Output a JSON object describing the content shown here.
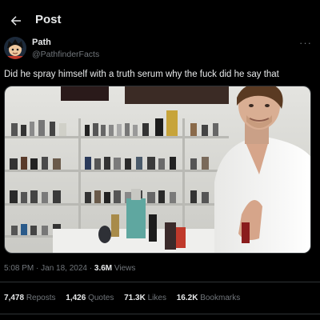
{
  "header": {
    "title": "Post",
    "back_icon": "arrow-left-icon"
  },
  "author": {
    "display_name": "Path",
    "handle": "@PathfinderFacts",
    "avatar_icon": "anime-avatar",
    "more_icon": "ellipsis-icon",
    "more_label": "···"
  },
  "tweet": {
    "text": "Did he spray himself with a truth serum why the fuck did he say that"
  },
  "media": {
    "description_icon": "video-thumbnail",
    "colors": {
      "wall": "#d9d9d6",
      "shirt": "#f4f4f2",
      "shelf": "#bfbfbb"
    }
  },
  "meta": {
    "time": "5:08 PM",
    "separator": "·",
    "date": "Jan 18, 2024",
    "views_count": "3.6M",
    "views_label": "Views"
  },
  "stats": {
    "reposts_count": "7,478",
    "reposts_label": "Reposts",
    "quotes_count": "1,426",
    "quotes_label": "Quotes",
    "likes_count": "71.3K",
    "likes_label": "Likes",
    "bookmarks_count": "16.2K",
    "bookmarks_label": "Bookmarks"
  },
  "colors": {
    "background": "#000000",
    "text": "#e7e9ea",
    "muted": "#71767b",
    "border": "#2f3336"
  }
}
